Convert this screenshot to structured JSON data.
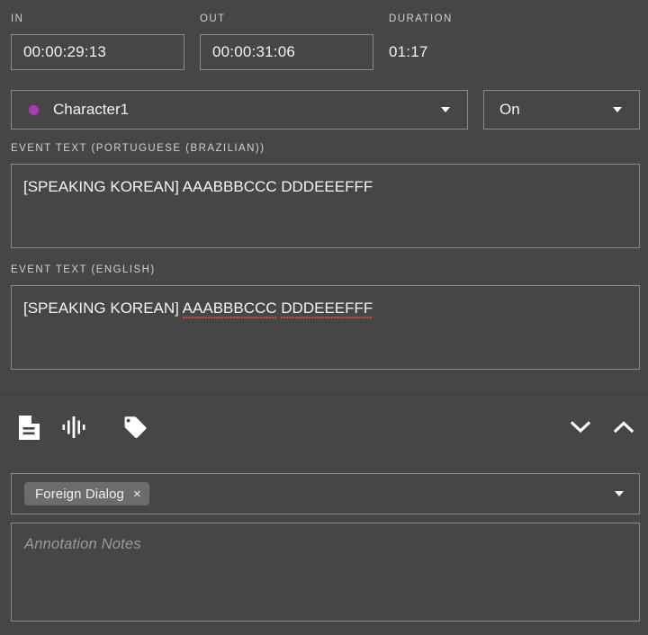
{
  "timecodes": {
    "in": {
      "label": "IN",
      "value": "00:00:29:13"
    },
    "out": {
      "label": "OUT",
      "value": "00:00:31:06"
    },
    "duration": {
      "label": "DURATION",
      "value": "01:17"
    }
  },
  "character_select": {
    "value": "Character1",
    "dot_color": "#b13cb1",
    "caret_icon": "chevron-down-icon"
  },
  "state_select": {
    "value": "On",
    "caret_icon": "chevron-down-icon"
  },
  "event_text_primary": {
    "label": "EVENT TEXT (PORTUGUESE (BRAZILIAN))",
    "value": "[SPEAKING KOREAN] AAABBBCCC DDDEEEFFF"
  },
  "event_text_secondary": {
    "label": "EVENT TEXT (ENGLISH)",
    "prefix": "[SPEAKING KOREAN] ",
    "misspelled_1": "AAABBBCCC",
    "separator": " ",
    "misspelled_2": "DDDEEEFFF",
    "spellcheck_color": "#e8442b"
  },
  "toolbar": {
    "icons": [
      {
        "name": "document-icon"
      },
      {
        "name": "waveform-icon"
      },
      {
        "name": "tag-icon"
      }
    ],
    "nav": [
      {
        "name": "chevron-down-icon"
      },
      {
        "name": "chevron-up-icon"
      }
    ]
  },
  "tags": {
    "chips": [
      {
        "label": "Foreign Dialog",
        "remove": "×"
      }
    ],
    "caret_icon": "chevron-down-icon"
  },
  "notes": {
    "placeholder": "Annotation Notes",
    "value": ""
  }
}
